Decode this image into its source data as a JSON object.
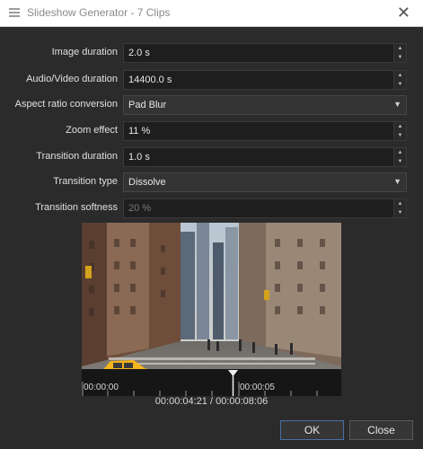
{
  "window": {
    "title": "Slideshow Generator - 7 Clips",
    "close_glyph": "✕"
  },
  "form": {
    "image_duration": {
      "label": "Image duration",
      "value": "2.0 s"
    },
    "av_duration": {
      "label": "Audio/Video duration",
      "value": "14400.0 s"
    },
    "aspect_ratio": {
      "label": "Aspect ratio conversion",
      "value": "Pad Blur"
    },
    "zoom_effect": {
      "label": "Zoom effect",
      "value": "11 %"
    },
    "transition_duration": {
      "label": "Transition duration",
      "value": "1.0 s"
    },
    "transition_type": {
      "label": "Transition type",
      "value": "Dissolve"
    },
    "transition_softness": {
      "label": "Transition softness",
      "value": "20 %"
    }
  },
  "preview": {
    "timeline": {
      "start_label": "00:00:00",
      "mid_label": "00:00:05"
    },
    "timecode": "00:00:04:21 / 00:00:08:06"
  },
  "buttons": {
    "ok": "OK",
    "close": "Close"
  },
  "colors": {
    "background": "#2b2b2b",
    "field": "#1e1e1e",
    "taxi": "#f2b51b",
    "accent": "#4a6fa5"
  }
}
